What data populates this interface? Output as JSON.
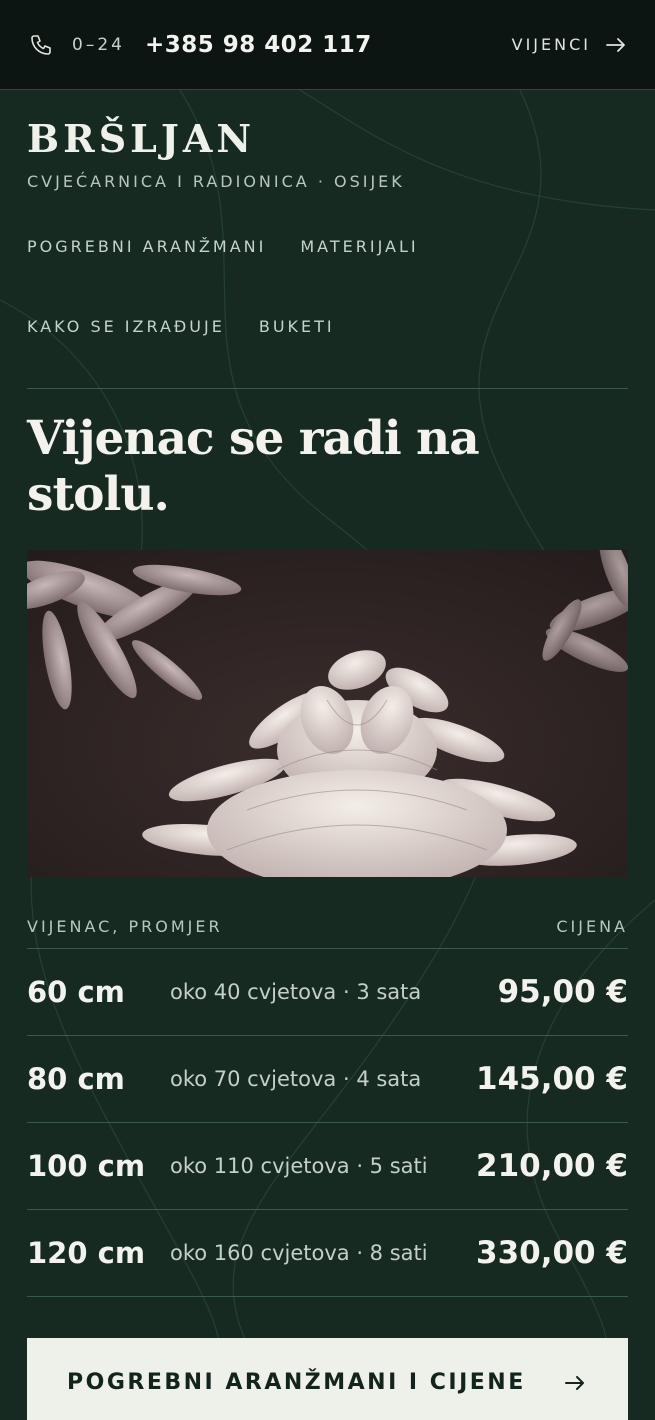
{
  "topbar": {
    "phone_icon": "phone-icon",
    "hours": "0–24",
    "phone_number": "+385 98 402 117",
    "link_label": "VIJENCI",
    "link_icon": "arrow-right-icon"
  },
  "brand": {
    "name": "BRŠLJAN",
    "tagline": "CVJEĆARNICA I RADIONICA · OSIJEK"
  },
  "nav": {
    "items": [
      {
        "label": "POGREBNI ARANŽMANI"
      },
      {
        "label": "MATERIJALI"
      },
      {
        "label": "KAKO SE IZRAĐUJE"
      },
      {
        "label": "BUKETI"
      }
    ]
  },
  "headline": "Vijenac se radi na stolu.",
  "photo": {
    "subject": "white chrysanthemum flowers"
  },
  "price_table": {
    "columns": [
      "VIJENAC, PROMJER",
      "CIJENA"
    ],
    "rows": [
      {
        "size": "60 cm",
        "details": "oko 40 cvjetova · 3 sata",
        "price": "95,00 €"
      },
      {
        "size": "80 cm",
        "details": "oko 70 cvjetova · 4 sata",
        "price": "145,00 €"
      },
      {
        "size": "100 cm",
        "details": "oko 110 cvjetova · 5 sati",
        "price": "210,00 €"
      },
      {
        "size": "120 cm",
        "details": "oko 160 cvjetova · 8 sati",
        "price": "330,00 €"
      }
    ]
  },
  "cta": {
    "label": "POGREBNI ARANŽMANI I CIJENE",
    "icon": "arrow-right-icon"
  },
  "colors": {
    "background": "#162a22",
    "topbar": "#0c1511",
    "cta_background": "#eef0ea",
    "text_light": "#ecefe8"
  }
}
